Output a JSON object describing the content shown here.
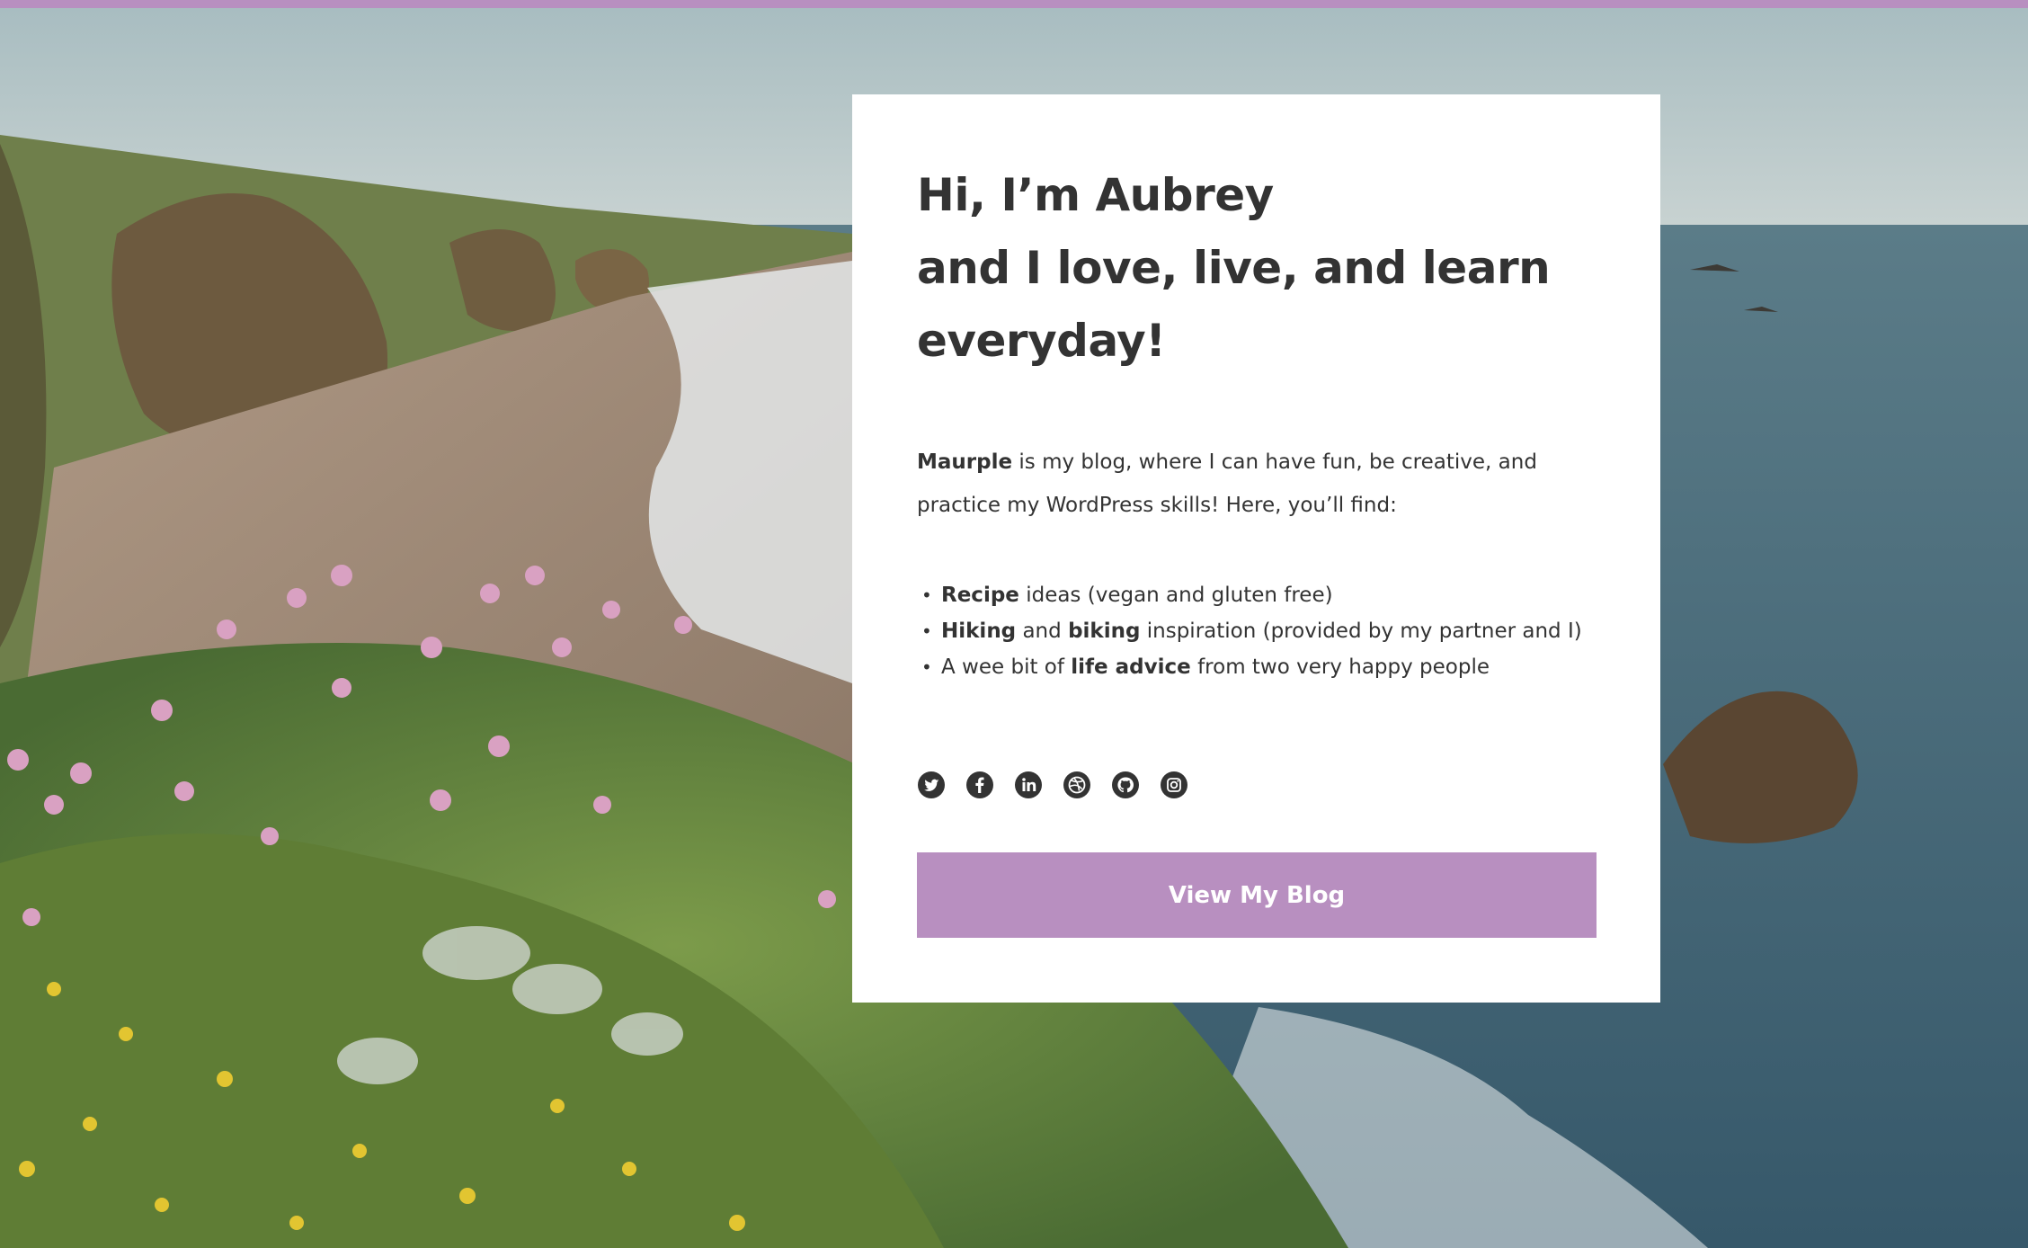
{
  "theme": {
    "accent": "#b88fc0",
    "card_background": "#ffffff",
    "text_color": "#333333"
  },
  "background": {
    "scene": "coastal cliff with pink sea-thrift flowers, sandy beach and ocean"
  },
  "hero": {
    "headline_lines": [
      "Hi, I’m Aubrey",
      "and I love, live, and learn",
      "everyday!"
    ],
    "intro": {
      "brand": "Maurple",
      "rest": " is my blog, where I can have fun, be creative, and practice my WordPress skills! Here, you’ll find:"
    },
    "features": [
      [
        {
          "text": "Recipe",
          "bold": true
        },
        {
          "text": " ideas (vegan and gluten free)",
          "bold": false
        }
      ],
      [
        {
          "text": "Hiking",
          "bold": true
        },
        {
          "text": " and ",
          "bold": false
        },
        {
          "text": "biking",
          "bold": true
        },
        {
          "text": " inspiration (provided by my partner and I)",
          "bold": false
        }
      ],
      [
        {
          "text": "A wee bit of ",
          "bold": false
        },
        {
          "text": "life advice",
          "bold": true
        },
        {
          "text": " from two very happy people",
          "bold": false
        }
      ]
    ],
    "social_icons": [
      "twitter-icon",
      "facebook-icon",
      "linkedin-icon",
      "dribbble-icon",
      "github-icon",
      "instagram-icon"
    ],
    "cta_label": "View My Blog"
  }
}
